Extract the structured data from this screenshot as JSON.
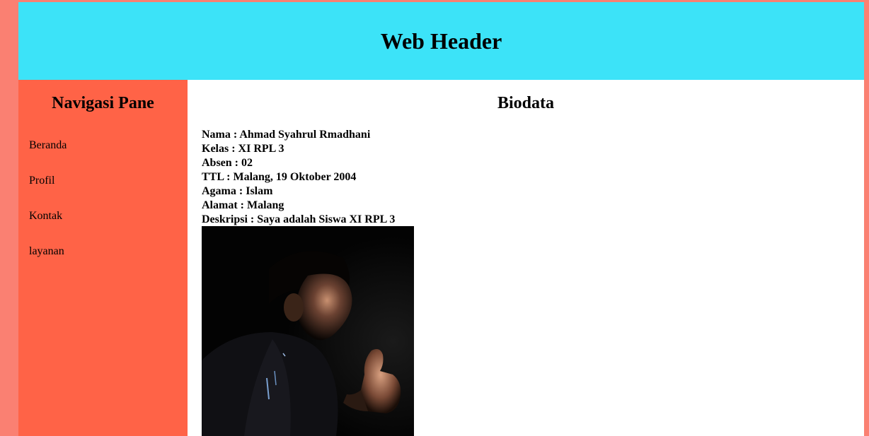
{
  "header": {
    "title": "Web Header"
  },
  "sidebar": {
    "title": "Navigasi Pane",
    "items": [
      {
        "label": "Beranda"
      },
      {
        "label": "Profil"
      },
      {
        "label": "Kontak"
      },
      {
        "label": "layanan"
      }
    ]
  },
  "main": {
    "title": "Biodata",
    "fields": [
      {
        "text": "Nama : Ahmad Syahrul Rmadhani"
      },
      {
        "text": "Kelas : XI RPL 3"
      },
      {
        "text": "Absen : 02"
      },
      {
        "text": "TTL : Malang, 19 Oktober 2004"
      },
      {
        "text": "Agama : Islam"
      },
      {
        "text": "Alamat : Malang"
      },
      {
        "text": "Deskripsi : Saya adalah Siswa XI RPL 3"
      }
    ],
    "photo": {
      "icon": "profile-photo"
    }
  },
  "colors": {
    "outer_background": "#fa8072",
    "header_background": "#3ce3f8",
    "sidebar_background": "#ff6347",
    "content_background": "#ffffff"
  }
}
